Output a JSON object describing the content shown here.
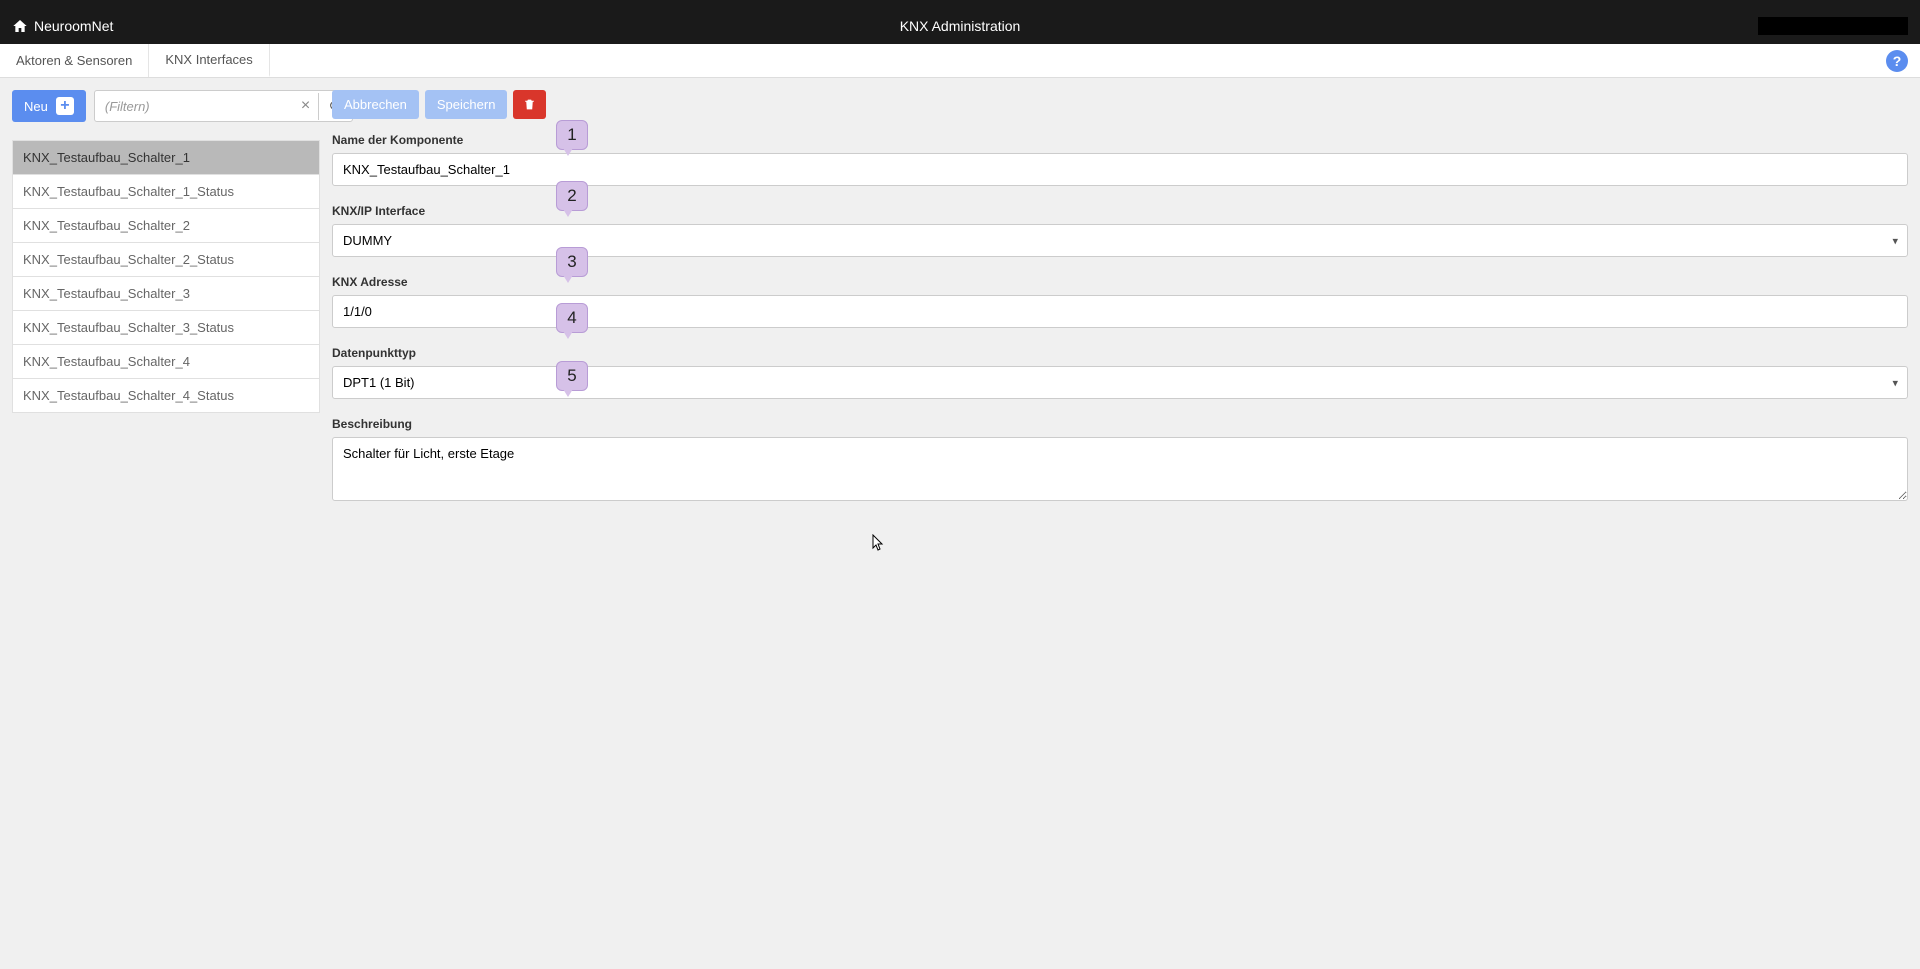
{
  "brand": "NeuroomNet",
  "page_title": "KNX Administration",
  "tabs": [
    {
      "label": "Aktoren & Sensoren",
      "active": false
    },
    {
      "label": "KNX Interfaces",
      "active": true
    }
  ],
  "sidebar": {
    "new_button": "Neu",
    "filter_placeholder": "(Filtern)",
    "items": [
      "KNX_Testaufbau_Schalter_1",
      "KNX_Testaufbau_Schalter_1_Status",
      "KNX_Testaufbau_Schalter_2",
      "KNX_Testaufbau_Schalter_2_Status",
      "KNX_Testaufbau_Schalter_3",
      "KNX_Testaufbau_Schalter_3_Status",
      "KNX_Testaufbau_Schalter_4",
      "KNX_Testaufbau_Schalter_4_Status"
    ],
    "selected_index": 0
  },
  "actions": {
    "cancel": "Abbrechen",
    "save": "Speichern"
  },
  "form": {
    "name_label": "Name der Komponente",
    "name_value": "KNX_Testaufbau_Schalter_1",
    "interface_label": "KNX/IP Interface",
    "interface_value": "DUMMY",
    "address_label": "KNX Adresse",
    "address_value": "1/1/0",
    "dpt_label": "Datenpunkttyp",
    "dpt_value": "DPT1 (1 Bit)",
    "desc_label": "Beschreibung",
    "desc_value": "Schalter für Licht, erste Etage"
  },
  "annotations": {
    "1": "1",
    "2": "2",
    "3": "3",
    "4": "4",
    "5": "5"
  }
}
